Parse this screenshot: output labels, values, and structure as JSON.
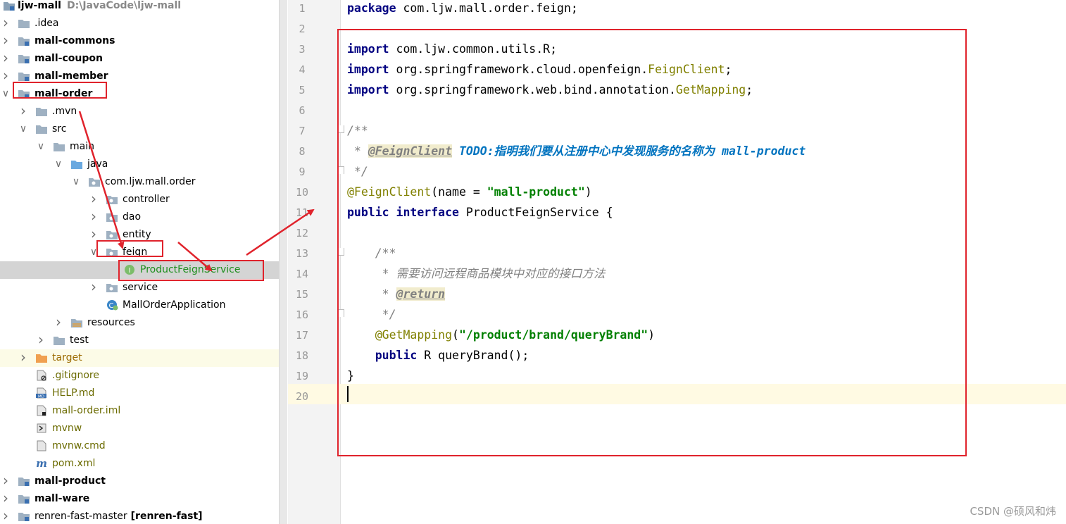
{
  "tree": {
    "root": {
      "name": "ljw-mall",
      "path": "D:\\JavaCode\\ljw-mall"
    },
    "items": [
      {
        "label": ".idea"
      },
      {
        "label": "mall-commons"
      },
      {
        "label": "mall-coupon"
      },
      {
        "label": "mall-member"
      },
      {
        "label": "mall-order"
      },
      {
        "label": ".mvn"
      },
      {
        "label": "src"
      },
      {
        "label": "main"
      },
      {
        "label": "java"
      },
      {
        "label": "com.ljw.mall.order"
      },
      {
        "label": "controller"
      },
      {
        "label": "dao"
      },
      {
        "label": "entity"
      },
      {
        "label": "feign"
      },
      {
        "label": "ProductFeignService"
      },
      {
        "label": "service"
      },
      {
        "label": "MallOrderApplication"
      },
      {
        "label": "resources"
      },
      {
        "label": "test"
      },
      {
        "label": "target"
      },
      {
        "label": ".gitignore"
      },
      {
        "label": "HELP.md"
      },
      {
        "label": "mall-order.iml"
      },
      {
        "label": "mvnw"
      },
      {
        "label": "mvnw.cmd"
      },
      {
        "label": "pom.xml"
      },
      {
        "label": "mall-product"
      },
      {
        "label": "mall-ware"
      },
      {
        "label": "renren-fast-master",
        "suffix": "[renren-fast]"
      }
    ]
  },
  "icons": {
    "folder": "folder-icon",
    "module": "module-folder-icon",
    "package": "package-icon",
    "interface": "interface-icon",
    "app": "spring-boot-class-icon",
    "file": "file-icon",
    "markdown": "markdown-icon",
    "maven": "maven-icon"
  },
  "editor": {
    "line_numbers": [
      "1",
      "2",
      "3",
      "4",
      "5",
      "6",
      "7",
      "8",
      "9",
      "10",
      "11",
      "12",
      "13",
      "14",
      "15",
      "16",
      "17",
      "18",
      "19",
      "20"
    ],
    "code": {
      "l1_kw": "package",
      "l1_rest": " com.ljw.mall.order.feign;",
      "l3_kw": "import",
      "l3_rest": " com.ljw.common.utils.R;",
      "l4_kw": "import",
      "l4_rest": " org.springframework.cloud.openfeign.",
      "l4_cls": "FeignClient",
      "l4_end": ";",
      "l5_kw": "import",
      "l5_rest": " org.springframework.web.bind.annotation.",
      "l5_cls": "GetMapping",
      "l5_end": ";",
      "l7": "/**",
      "l8_star": " * ",
      "l8_tag": "@FeignClient",
      "l8_todo": " TODO:指明我们要从注册中心中发现服务的名称为 mall-product",
      "l9": " */",
      "l10_ann": "@FeignClient",
      "l10_a": "(name = ",
      "l10_str": "\"mall-product\"",
      "l10_b": ")",
      "l11_kw1": "public",
      "l11_kw2": " interface",
      "l11_rest": " ProductFeignService {",
      "l13": "    /**",
      "l14": "     * 需要访问远程商品模块中对应的接口方法",
      "l15_star": "     * ",
      "l15_tag": "@return",
      "l16": "     */",
      "l17_ann": "    @GetMapping",
      "l17_a": "(",
      "l17_str": "\"/product/brand/queryBrand\"",
      "l17_b": ")",
      "l18_kw": "    public",
      "l18_rest": " R queryBrand();",
      "l19": "}"
    }
  },
  "watermark": "CSDN @硕风和炜",
  "colors": {
    "annotation_red": "#e0232c",
    "selection": "#d4d4d4"
  }
}
